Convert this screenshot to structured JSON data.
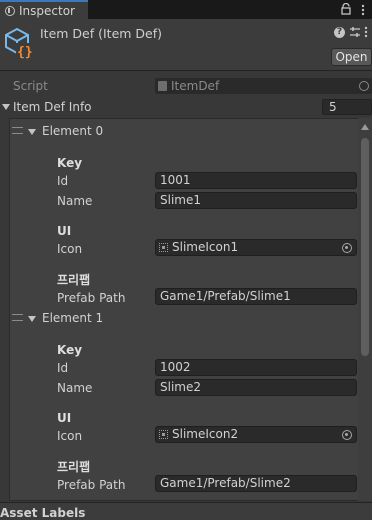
{
  "tab": {
    "label": "Inspector"
  },
  "header": {
    "title": "Item Def (Item Def)",
    "open_label": "Open"
  },
  "script": {
    "label": "Script",
    "value": "ItemDef"
  },
  "list": {
    "label": "Item Def Info",
    "size": "5",
    "elements": [
      {
        "label": "Element 0",
        "key_header": "Key",
        "id_label": "Id",
        "id_value": "1001",
        "name_label": "Name",
        "name_value": "Slime1",
        "ui_header": "UI",
        "icon_label": "Icon",
        "icon_value": "SlimeIcon1",
        "prefab_header": "프리팹",
        "prefab_label": "Prefab Path",
        "prefab_value": "Game1/Prefab/Slime1"
      },
      {
        "label": "Element 1",
        "key_header": "Key",
        "id_label": "Id",
        "id_value": "1002",
        "name_label": "Name",
        "name_value": "Slime2",
        "ui_header": "UI",
        "icon_label": "Icon",
        "icon_value": "SlimeIcon2",
        "prefab_header": "프리팹",
        "prefab_label": "Prefab Path",
        "prefab_value": "Game1/Prefab/Slime2"
      }
    ]
  },
  "footer": {
    "label": "Asset Labels"
  },
  "colors": {
    "accent": "#3a79bb",
    "so_icon_orange": "#f08c3a",
    "so_icon_blue": "#7ab8e8"
  },
  "icons": [
    "inspector-icon",
    "lock-icon",
    "menu-icon",
    "scriptable-object-icon",
    "help-icon",
    "settings-icon",
    "more-icon",
    "script-file-icon",
    "target-icon",
    "drag-handle-icon",
    "foldout-arrow-icon",
    "sprite-icon",
    "object-picker-icon"
  ]
}
